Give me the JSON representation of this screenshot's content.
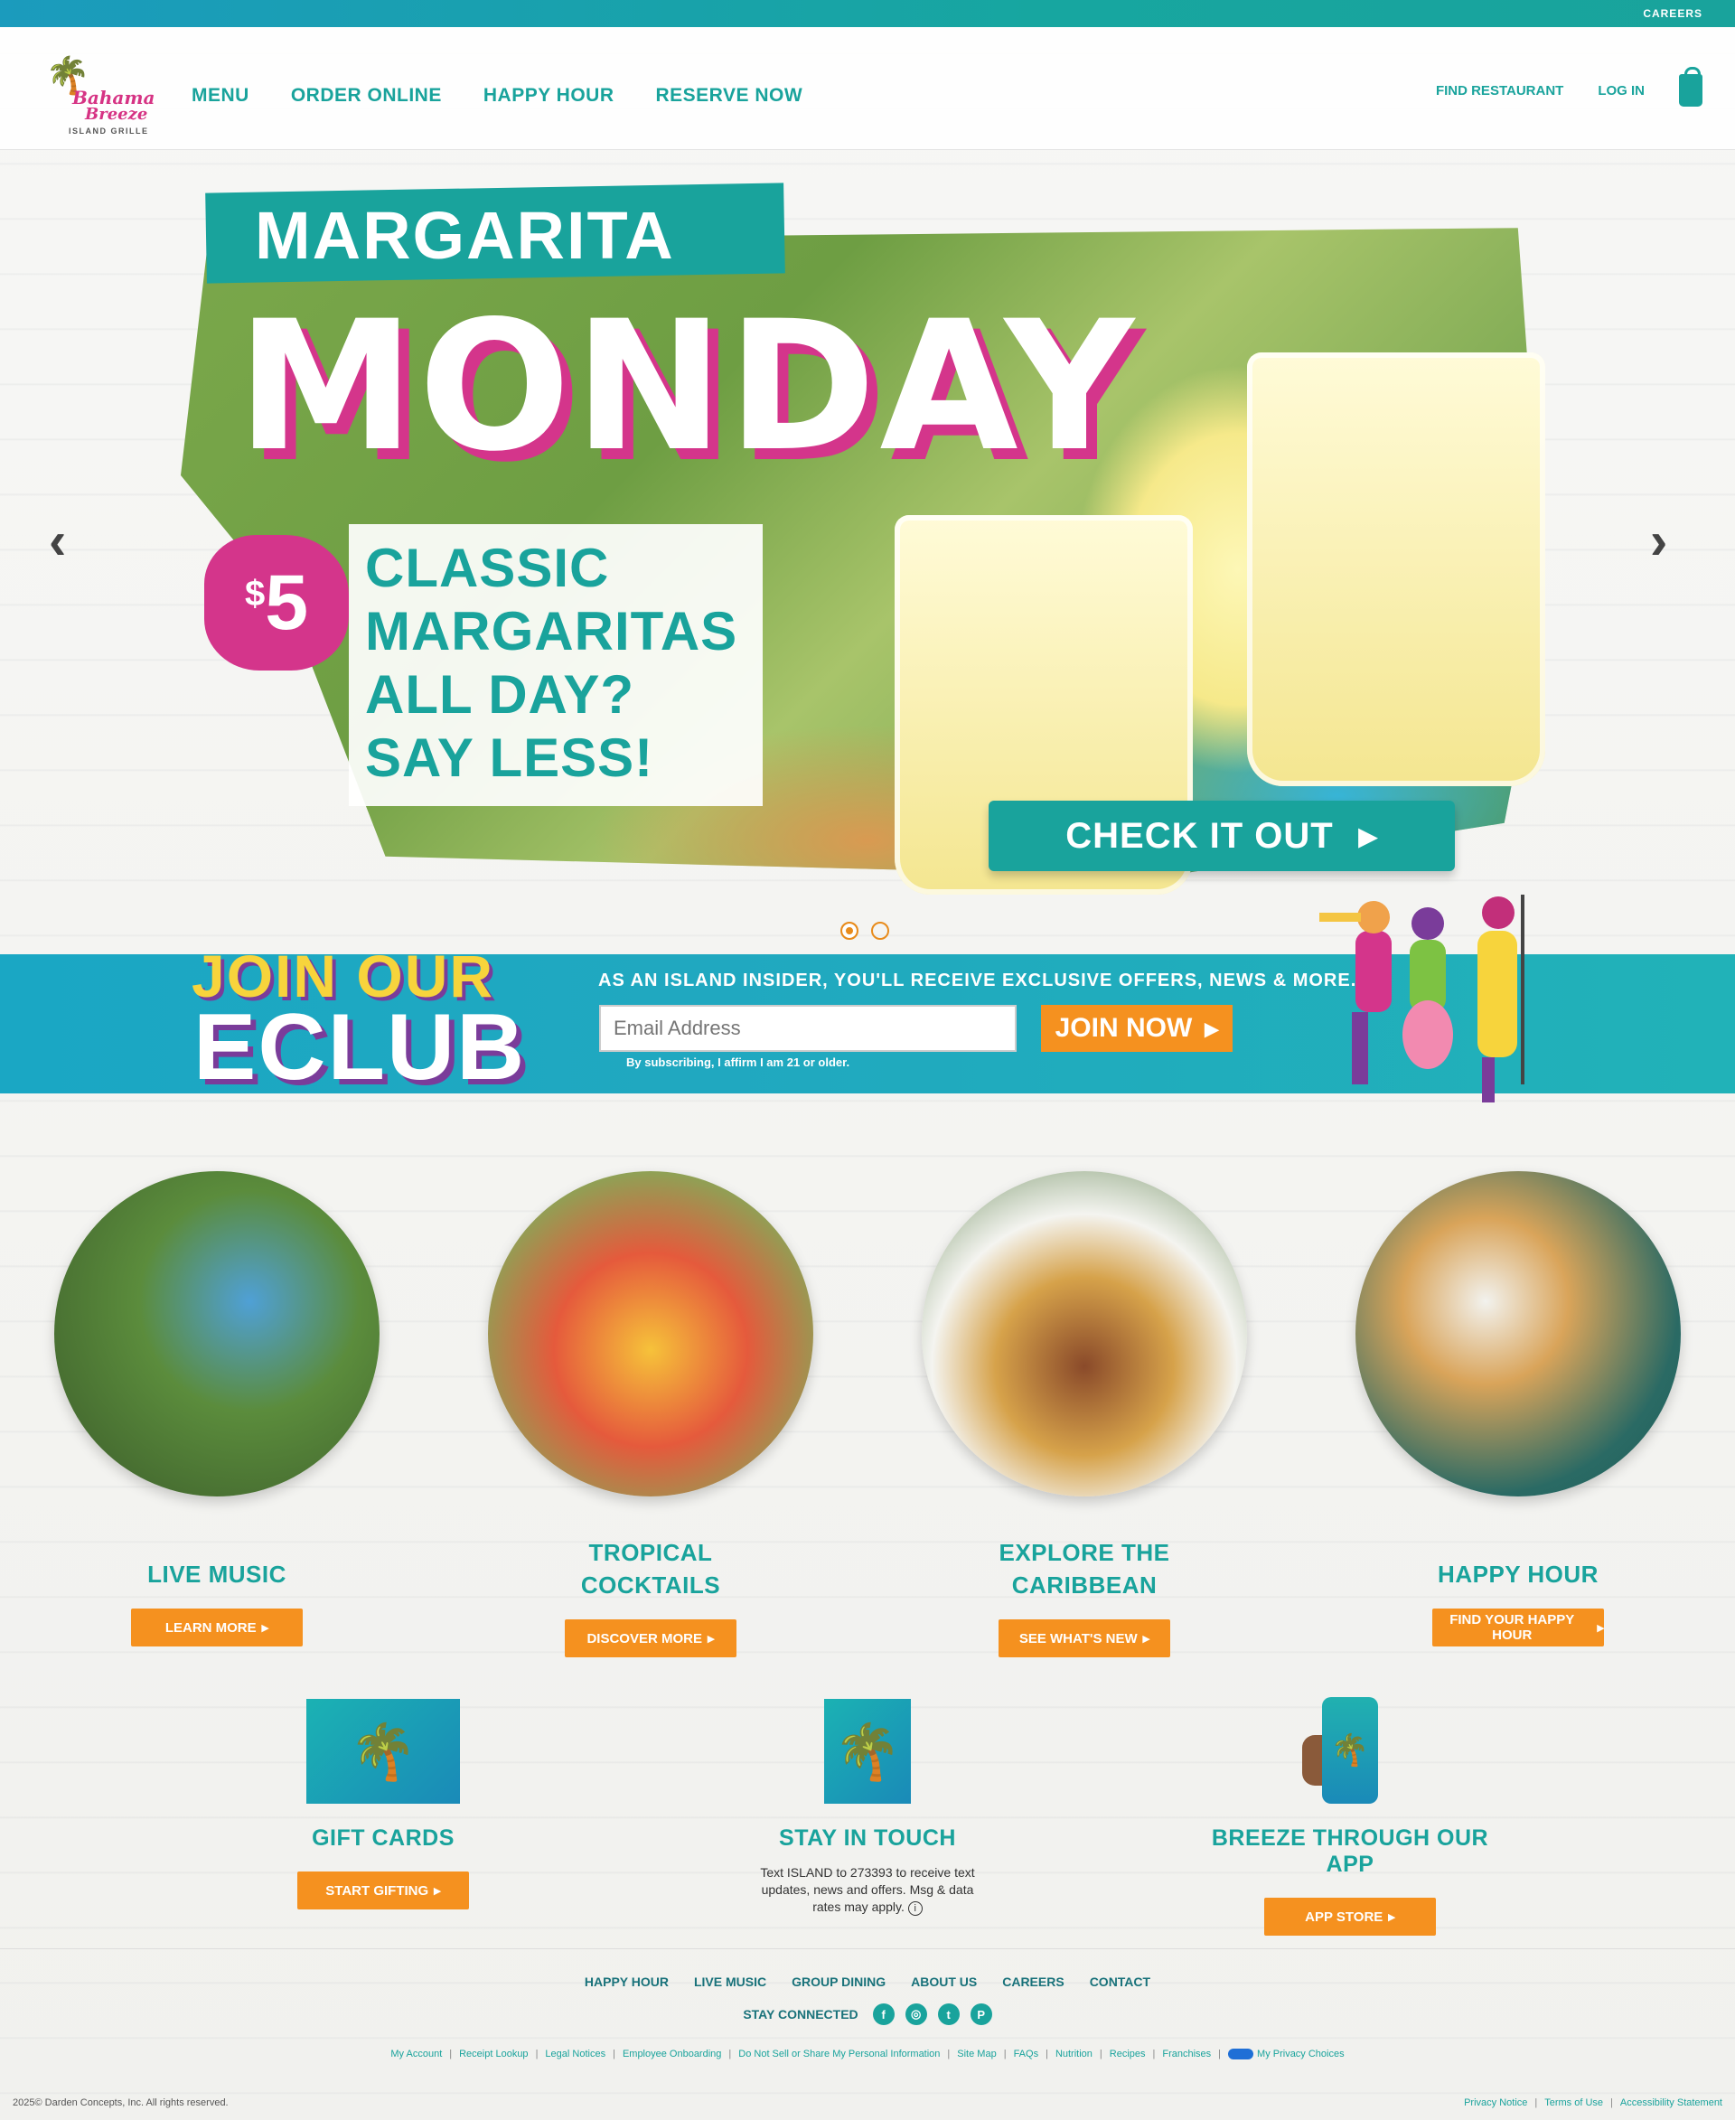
{
  "topbar": {
    "careers": "CAREERS"
  },
  "logo": {
    "line1": "Bahama",
    "line2": "Breeze",
    "line3": "ISLAND GRILLE"
  },
  "nav": {
    "menu": "MENU",
    "order": "ORDER ONLINE",
    "happy": "HAPPY HOUR",
    "reserve": "RESERVE NOW"
  },
  "rightnav": {
    "find": "FIND RESTAURANT",
    "login": "LOG IN"
  },
  "hero": {
    "tag": "MARGARITA",
    "title": "MONDAY",
    "price": "5",
    "price_symbol": "$",
    "lines": [
      "CLASSIC",
      "MARGARITAS",
      "ALL DAY?",
      "SAY LESS!"
    ],
    "cta": "CHECK IT OUT",
    "prev": "‹",
    "next": "›",
    "slides_count": 2,
    "active_slide": 1
  },
  "eclub": {
    "join": "JOIN OUR",
    "club": "ECLUB",
    "desc": "AS AN ISLAND INSIDER, YOU'LL RECEIVE EXCLUSIVE OFFERS, NEWS & MORE.",
    "placeholder": "Email Address",
    "button": "JOIN NOW",
    "affirm": "By subscribing, I affirm I am 21 or older."
  },
  "features": [
    {
      "title": "LIVE MUSIC",
      "button": "LEARN MORE"
    },
    {
      "title": "TROPICAL COCKTAILS",
      "button": "DISCOVER MORE"
    },
    {
      "title": "EXPLORE THE CARIBBEAN",
      "button": "SEE WHAT'S NEW"
    },
    {
      "title": "HAPPY HOUR",
      "button": "FIND YOUR HAPPY HOUR"
    }
  ],
  "small": {
    "gift": {
      "title": "GIFT CARDS",
      "button": "START GIFTING"
    },
    "touch": {
      "title": "STAY IN TOUCH",
      "text": "Text ISLAND to 273393 to receive text updates, news and offers. Msg & data rates may apply."
    },
    "app": {
      "title": "BREEZE THROUGH OUR APP",
      "button": "APP STORE"
    }
  },
  "footer": {
    "nav": [
      "HAPPY HOUR",
      "LIVE MUSIC",
      "GROUP DINING",
      "ABOUT US",
      "CAREERS",
      "CONTACT"
    ],
    "stay": "STAY CONNECTED",
    "social": [
      "f",
      "◎",
      "t",
      "P"
    ],
    "legal": [
      "My Account",
      "Receipt Lookup",
      "Legal Notices",
      "Employee Onboarding",
      "Do Not Sell or Share My Personal Information",
      "Site Map",
      "FAQs",
      "Nutrition",
      "Recipes",
      "Franchises"
    ],
    "privacy_choices": "My Privacy Choices",
    "copyright": "2025© Darden Concepts, Inc. All rights reserved.",
    "bottom": [
      "Privacy Notice",
      "Terms of Use",
      "Accessibility Statement"
    ]
  },
  "colors": {
    "teal": "#19a39c",
    "orange": "#f5911f",
    "pink": "#d4358b",
    "yellow": "#f7d43c",
    "purple": "#7a3c9a"
  }
}
